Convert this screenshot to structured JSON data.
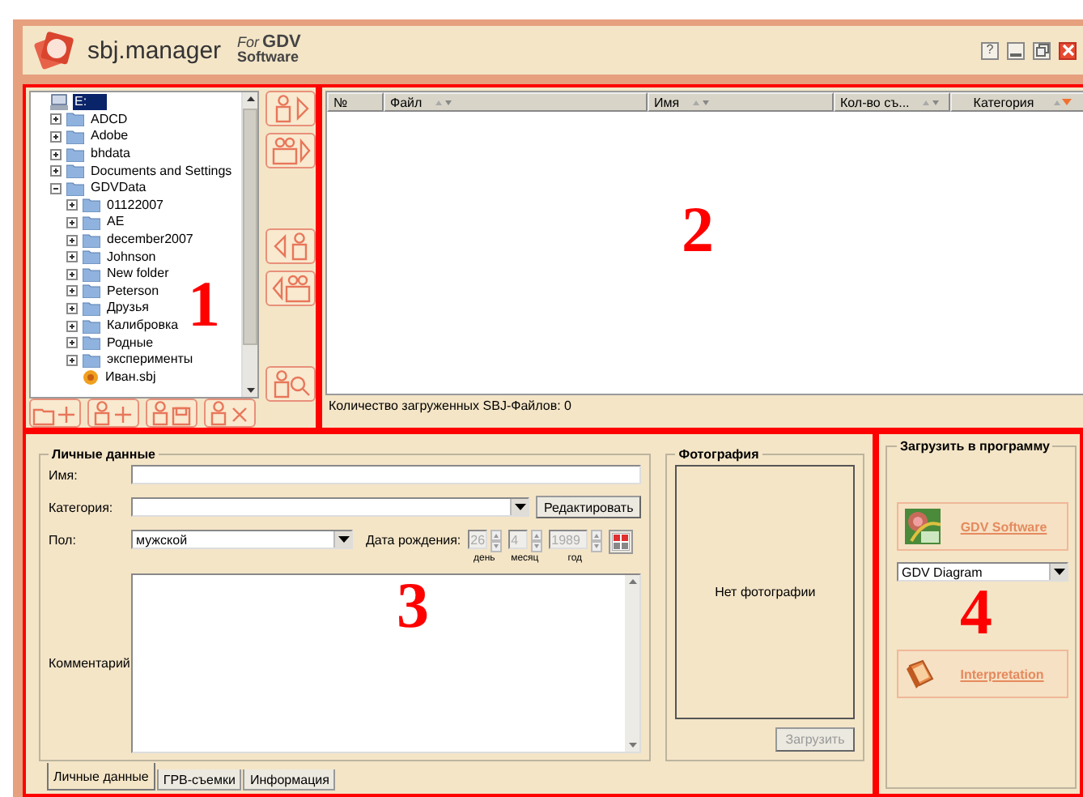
{
  "window": {
    "title": "sbj.manager",
    "brand_for": "For",
    "brand_name": "GDV",
    "brand_software": "Software",
    "help_glyph": "?"
  },
  "tree": {
    "items": [
      {
        "label": "E:",
        "kind": "drive",
        "selected": true,
        "children": [
          {
            "label": "ADCD",
            "kind": "folder",
            "expanded": false,
            "selected": false
          },
          {
            "label": "Adobe",
            "kind": "folder",
            "expanded": false,
            "selected": false
          },
          {
            "label": "bhdata",
            "kind": "folder",
            "expanded": false,
            "selected": false
          },
          {
            "label": "Documents and Settings",
            "kind": "folder",
            "expanded": false,
            "selected": false
          },
          {
            "label": "GDVData",
            "kind": "folder",
            "expanded": true,
            "selected": false,
            "children": [
              {
                "label": "01122007",
                "kind": "folder",
                "expanded": false,
                "selected": false
              },
              {
                "label": "AE",
                "kind": "folder",
                "expanded": false,
                "selected": false
              },
              {
                "label": "december2007",
                "kind": "folder",
                "expanded": false,
                "selected": false
              },
              {
                "label": "Johnson",
                "kind": "folder",
                "expanded": false,
                "selected": false
              },
              {
                "label": "New folder",
                "kind": "folder",
                "expanded": false,
                "selected": false
              },
              {
                "label": "Peterson",
                "kind": "folder",
                "expanded": false,
                "selected": false
              },
              {
                "label": "Друзья",
                "kind": "folder",
                "expanded": false,
                "selected": false
              },
              {
                "label": "Калибровка",
                "kind": "folder",
                "expanded": false,
                "selected": false
              },
              {
                "label": "Родные",
                "kind": "folder",
                "expanded": false,
                "selected": false
              },
              {
                "label": "эксперименты",
                "kind": "folder",
                "expanded": false,
                "selected": false
              },
              {
                "label": "Иван.sbj",
                "kind": "file",
                "selected": false
              }
            ]
          }
        ]
      }
    ]
  },
  "file_table": {
    "columns": [
      {
        "label": "№",
        "sortable": false,
        "sorted": false
      },
      {
        "label": "Файл",
        "sortable": true,
        "sorted": false
      },
      {
        "label": "Имя",
        "sortable": true,
        "sorted": false
      },
      {
        "label": "Кол-во съ...",
        "sortable": true,
        "sorted": false
      },
      {
        "label": "Категория",
        "sortable": true,
        "sorted": true
      }
    ],
    "status": "Количество загруженных SBJ-Файлов: 0"
  },
  "personal": {
    "legend": "Личные данные",
    "name_label": "Имя:",
    "category_label": "Категория:",
    "edit_button": "Редактировать",
    "gender_label": "Пол:",
    "gender_value": "мужской",
    "birth_label": "Дата рождения:",
    "birth_disabled": true,
    "day": {
      "value": "26",
      "caption": "день"
    },
    "month": {
      "value": "4",
      "caption": "месяц"
    },
    "year": {
      "value": "1989",
      "caption": "год"
    },
    "comment_label": "Комментарий"
  },
  "photo": {
    "legend": "Фотография",
    "empty_text": "Нет фотографии",
    "upload_button": "Загрузить",
    "upload_disabled": true
  },
  "tabs": [
    {
      "label": "Личные данные",
      "selected": true
    },
    {
      "label": "ГРВ-съемки",
      "selected": false
    },
    {
      "label": "Информация",
      "selected": false
    }
  ],
  "load": {
    "legend": "Загрузить в программу",
    "software_button": "GDV Software",
    "diagram_select": "GDV Diagram",
    "interpretation_button": "Interpretation"
  },
  "annotations": [
    "1",
    "2",
    "3",
    "4"
  ]
}
